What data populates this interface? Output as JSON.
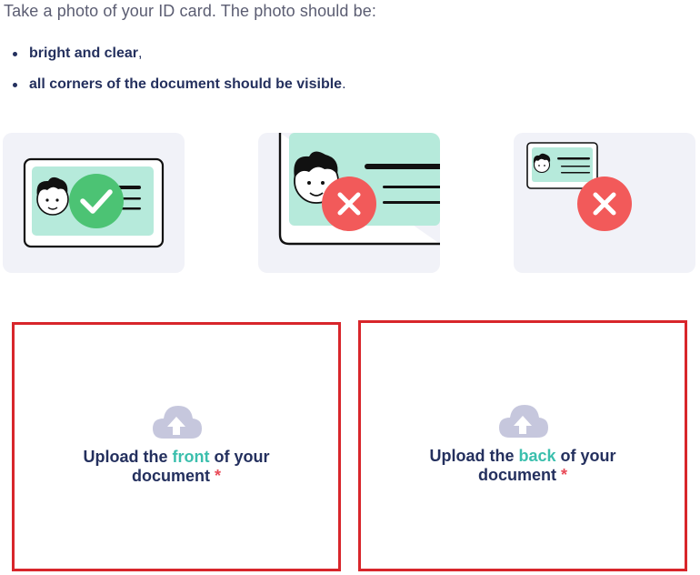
{
  "instructions": {
    "intro": "Take a photo of your ID card. The photo should be:",
    "bullets": [
      {
        "bold": "bright and clear",
        "suffix": ","
      },
      {
        "bold": "all corners of the document should be visible",
        "suffix": "."
      }
    ]
  },
  "examples": [
    {
      "icon": "check-icon",
      "status": "correct"
    },
    {
      "icon": "cross-icon",
      "status": "too-close"
    },
    {
      "icon": "cross-icon",
      "status": "too-far"
    }
  ],
  "upload_front": {
    "prefix": "Upload the ",
    "highlight": "front",
    "suffix": " of your document",
    "required_mark": "*"
  },
  "upload_back": {
    "prefix": "Upload the ",
    "highlight": "back",
    "suffix": " of your document",
    "required_mark": "*"
  },
  "colors": {
    "text_dark": "#24305e",
    "accent_teal": "#3bbfad",
    "success_green": "#4cc374",
    "error_red": "#f25a5a",
    "card_mint": "#b6eadb",
    "highlight_border": "#d8262b",
    "illustration_bg": "#f1f2f8",
    "cloud_icon": "#c6c7dd"
  }
}
